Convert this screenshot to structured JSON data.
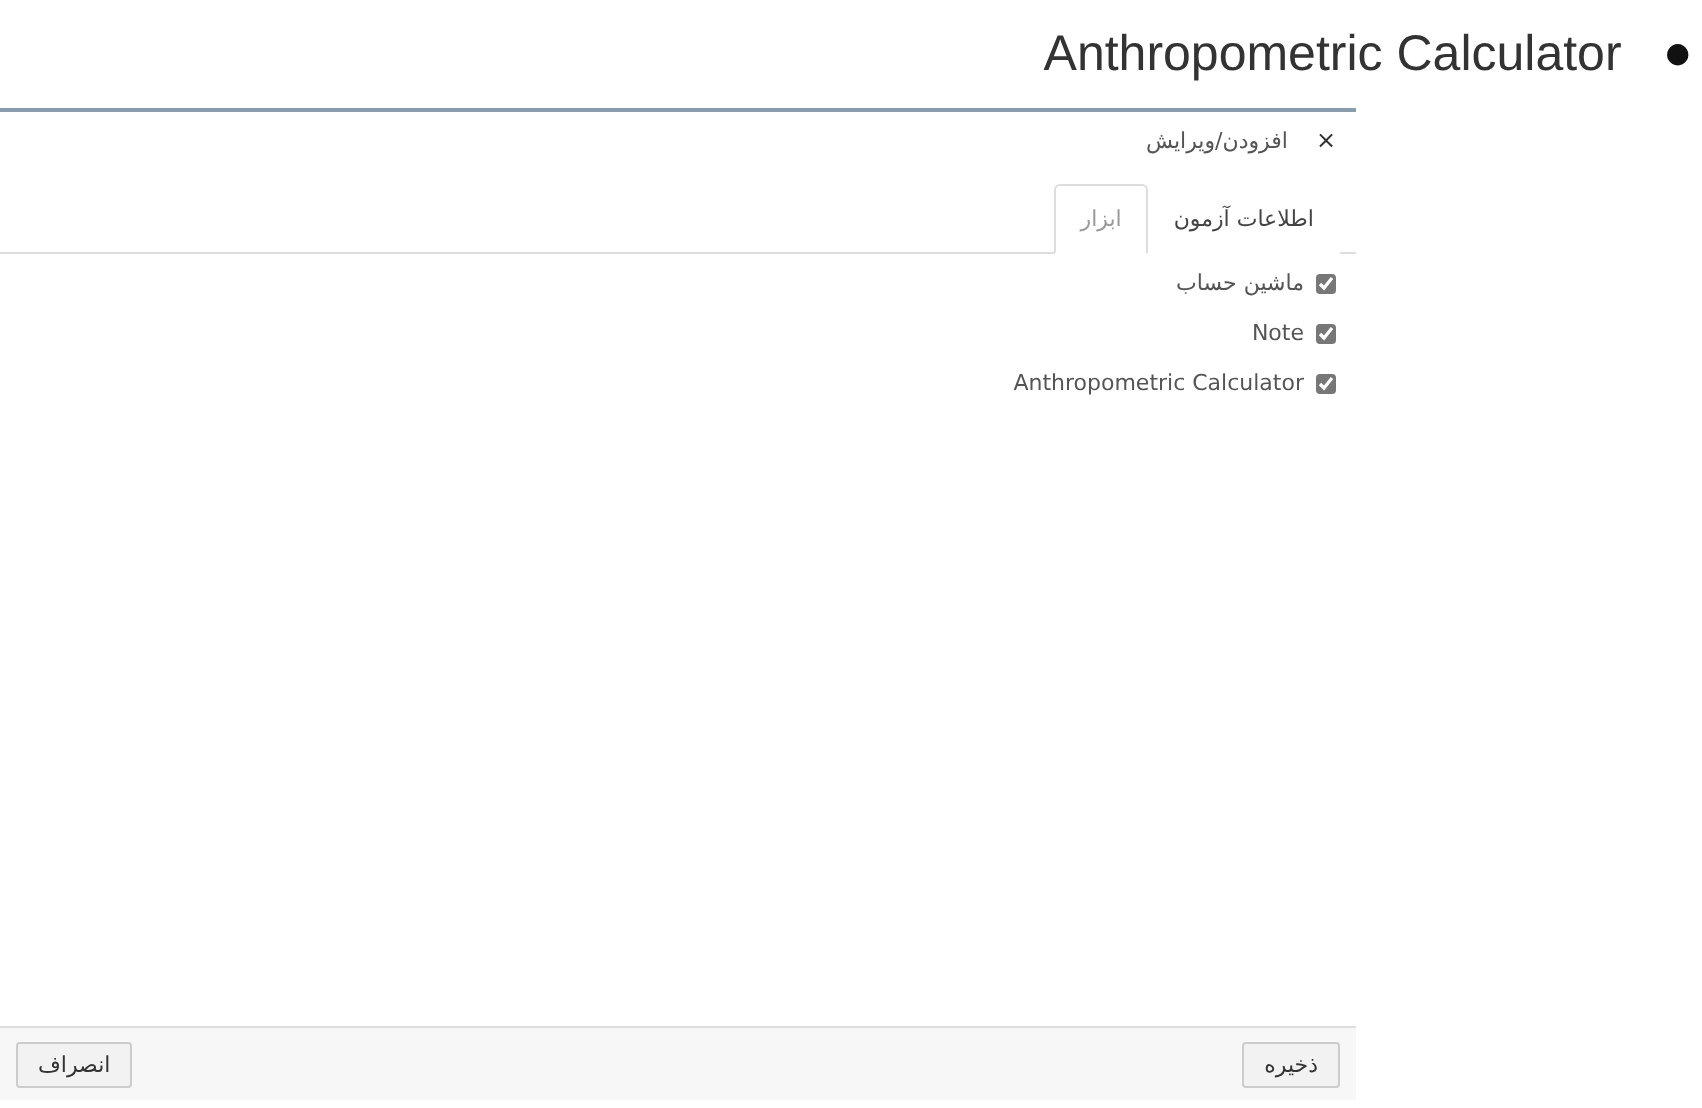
{
  "heading": {
    "bullet": "●",
    "text": "Anthropometric Calculator"
  },
  "dialog": {
    "title": "افزودن/ویرایش",
    "close": "×",
    "tabs": [
      {
        "label": "اطلاعات آزمون",
        "selected": false
      },
      {
        "label": "ابزار",
        "selected": true
      }
    ],
    "tools": [
      {
        "label": "ماشین حساب",
        "checked": true
      },
      {
        "label": "Note",
        "checked": true
      },
      {
        "label": "Anthropometric Calculator",
        "checked": true
      }
    ],
    "buttons": {
      "save": "ذخیره",
      "cancel": "انصراف"
    }
  }
}
